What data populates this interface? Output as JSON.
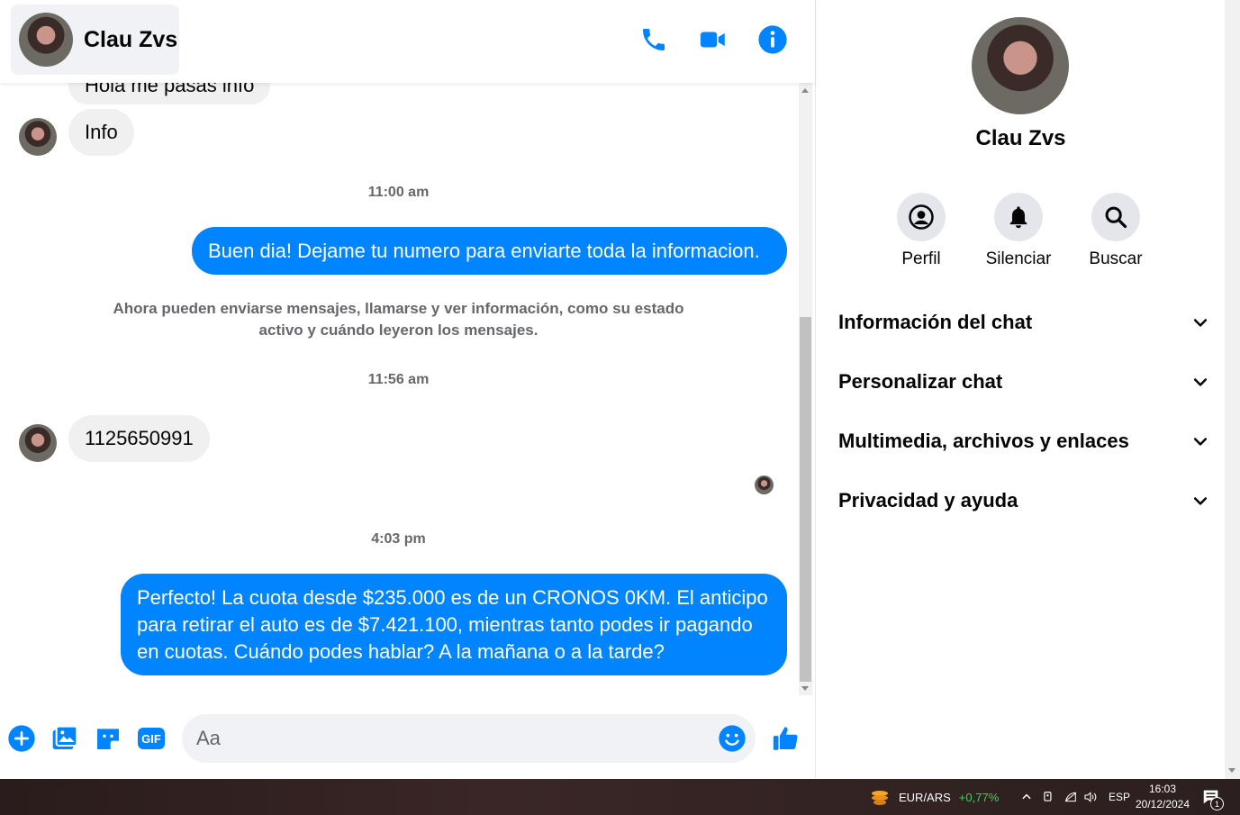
{
  "header": {
    "contact_name": "Clau Zvs"
  },
  "messages": {
    "partial_incoming": "Hola me pasas info",
    "incoming_1": "Info",
    "time_1": "11:00 am",
    "outgoing_1": "Buen dia! Dejame tu numero para enviarte toda la informacion.",
    "system_note": "Ahora pueden enviarse mensajes, llamarse y ver información, como su estado activo y cuándo leyeron los mensajes.",
    "time_2": "11:56 am",
    "incoming_2": "1125650991",
    "time_3": "4:03 pm",
    "outgoing_2": "Perfecto! La cuota desde $235.000 es de un CRONOS 0KM. El anticipo para retirar el auto es de $7.421.100, mientras tanto podes ir pagando en cuotas. Cuándo podes hablar? A la mañana o a la tarde?"
  },
  "composer": {
    "placeholder": "Aa",
    "gif_label": "GIF"
  },
  "info_panel": {
    "name": "Clau Zvs",
    "actions": [
      "Perfil",
      "Silenciar",
      "Buscar"
    ],
    "sections": [
      "Información del chat",
      "Personalizar chat",
      "Multimedia, archivos y enlaces",
      "Privacidad y ayuda"
    ]
  },
  "taskbar": {
    "ticker": "EUR/ARS",
    "ticker_change": "+0,77%",
    "language": "ESP",
    "time": "16:03",
    "date": "20/12/2024",
    "notification_count": "1"
  },
  "colors": {
    "accent": "#0084ff",
    "incoming_bubble": "#f0f0f0",
    "ticker_up": "#3ccf5c"
  }
}
